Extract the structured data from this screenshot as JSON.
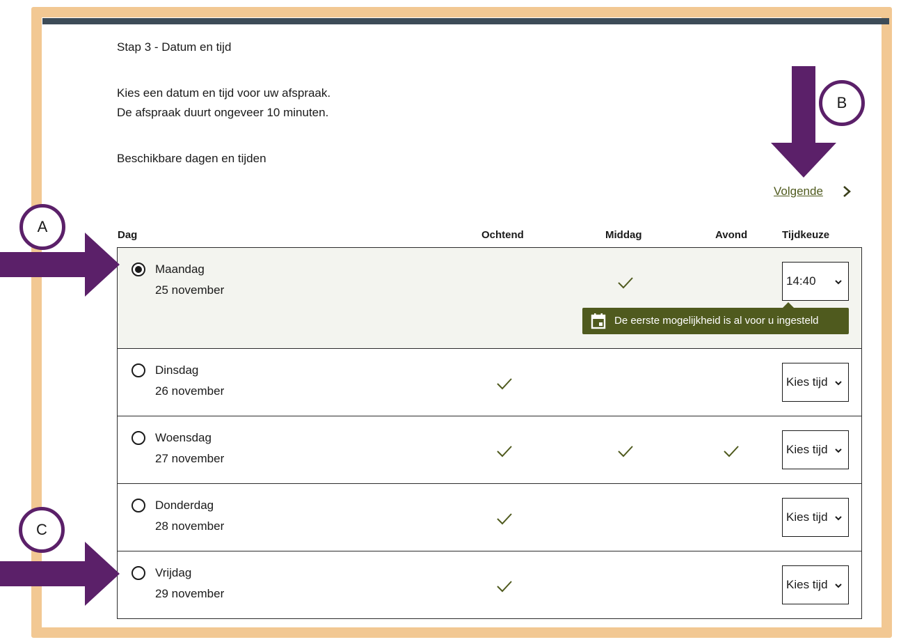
{
  "page": {
    "step_title": "Stap 3 - Datum en tijd",
    "intro_line1": "Kies een datum en tijd voor uw afspraak.",
    "intro_line2": "De afspraak duurt ongeveer 10 minuten.",
    "available_heading": "Beschikbare dagen en tijden",
    "next_link": "Volgende"
  },
  "table": {
    "headers": {
      "day": "Dag",
      "morning": "Ochtend",
      "afternoon": "Middag",
      "evening": "Avond",
      "choice": "Tijdkeuze"
    },
    "rows": [
      {
        "day": "Maandag",
        "date": "25 november",
        "selected": true,
        "morning": false,
        "afternoon": true,
        "evening": false,
        "time": "14:40"
      },
      {
        "day": "Dinsdag",
        "date": "26 november",
        "selected": false,
        "morning": true,
        "afternoon": false,
        "evening": false,
        "time": "Kies tijd"
      },
      {
        "day": "Woensdag",
        "date": "27 november",
        "selected": false,
        "morning": true,
        "afternoon": true,
        "evening": true,
        "time": "Kies tijd"
      },
      {
        "day": "Donderdag",
        "date": "28 november",
        "selected": false,
        "morning": true,
        "afternoon": false,
        "evening": false,
        "time": "Kies tijd"
      },
      {
        "day": "Vrijdag",
        "date": "29 november",
        "selected": false,
        "morning": true,
        "afternoon": false,
        "evening": false,
        "time": "Kies tijd"
      }
    ]
  },
  "tooltip": {
    "text": "De eerste mogelijkheid is al voor u ingesteld",
    "icon": "calendar-icon"
  },
  "annotations": {
    "a": "A",
    "b": "B",
    "c": "C"
  },
  "colors": {
    "frame": "#f2c893",
    "top_bar": "#3d4c58",
    "accent_green": "#4f5a1e",
    "marker_purple": "#5b2069",
    "selected_row_bg": "#f3f4ef"
  }
}
